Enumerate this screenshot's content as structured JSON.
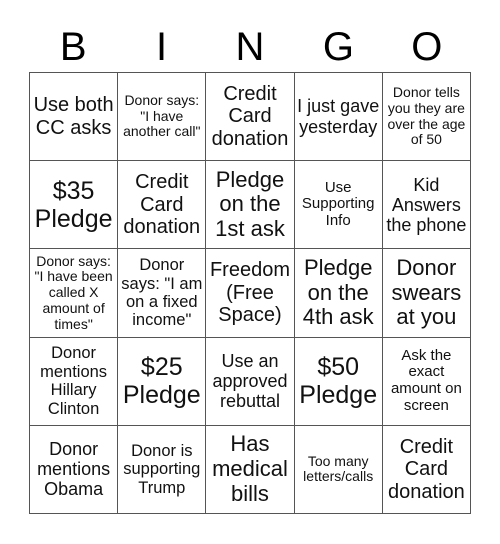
{
  "header": [
    "B",
    "I",
    "N",
    "G",
    "O"
  ],
  "cells": [
    [
      "Use both CC asks",
      "Donor says: \"I have another call\"",
      "Credit Card donation",
      "I just gave yesterday",
      "Donor tells you they are over the age of 50"
    ],
    [
      "$35 Pledge",
      "Credit Card donation",
      "Pledge on the 1st ask",
      "Use Supporting Info",
      "Kid Answers the phone"
    ],
    [
      "Donor says: \"I have been called X amount of times\"",
      "Donor says: \"I am on a fixed income\"",
      "Freedom (Free Space)",
      "Pledge on the 4th ask",
      "Donor swears at you"
    ],
    [
      "Donor mentions Hillary Clinton",
      "$25 Pledge",
      "Use an approved rebuttal",
      "$50 Pledge",
      "Ask the exact amount on screen"
    ],
    [
      "Donor mentions Obama",
      "Donor is supporting Trump",
      "Has medical bills",
      "Too many letters/calls",
      "Credit Card donation"
    ]
  ]
}
